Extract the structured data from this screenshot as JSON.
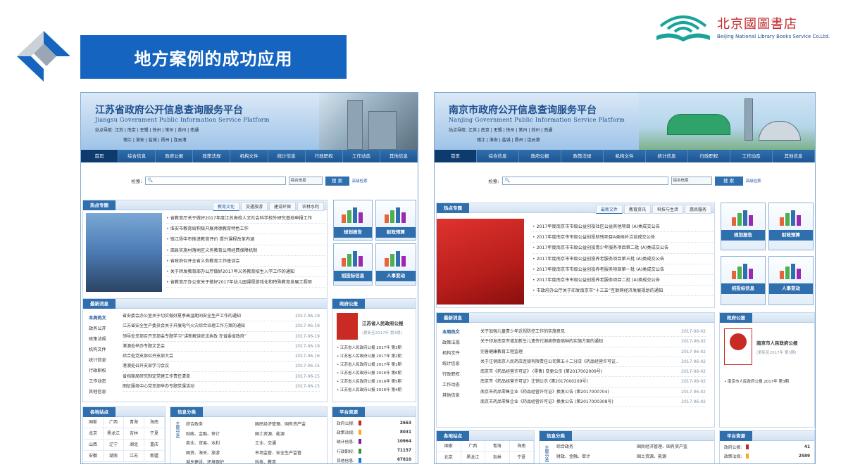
{
  "slide": {
    "title": "地方案例的成功应用",
    "brand": {
      "zh": "北京國圖書店",
      "en": "Beijing National Library Books Service Co.Ltd."
    }
  },
  "colors": {
    "accent": "#1565c0",
    "nav": "#1f5592",
    "brand_red": "#c0262b"
  },
  "left_site": {
    "title": "江苏省政府公开信息查询服务平台",
    "title_en": "Jiangsu Government Public Information Service Platform",
    "nav_label": "站点导航:",
    "nav_row1": [
      "江苏",
      "南京",
      "无锡",
      "徐州",
      "常州",
      "苏州",
      "南通"
    ],
    "nav_row2": [
      "镇江",
      "淮安",
      "盐城",
      "扬州",
      "连云港"
    ],
    "menu": [
      "首页",
      "综合信息",
      "政府公报",
      "政策法规",
      "机构文件",
      "统计信息",
      "行政职权",
      "工作动态",
      "其他信息"
    ],
    "search": {
      "label": "检索:",
      "select": "综合信息",
      "button": "搜 索",
      "advanced": "高级检索"
    },
    "hot": {
      "title": "热点专题",
      "tabs": [
        "教育文化",
        "交通旅游",
        "建设环保",
        "农林水利"
      ],
      "news": [
        "省教育厅关于做好2017年度江苏高校人文社会科学校外研究基地申报工作",
        "淮安市教育局积极开展师德教育特色工作",
        "镇江扬中市推进教育评价 提升课程改革内涵",
        "泗县实施村落地区义务教育公用经费保障机制",
        "省政府召开全省义务教育工作座谈会",
        "关于转发教育部办公厅做好2017年义务教育招生入学工作的通知",
        "省教育厅办公室关于做好2017年幼儿园课程游戏化和特殊教育发展工程项"
      ],
      "pager": [
        "1",
        "2",
        "3",
        "4",
        "5"
      ]
    },
    "side_buttons": [
      "规划报告",
      "财政预算",
      "招投标信息",
      "人事变动"
    ],
    "latest": {
      "title": "最新消息",
      "sidenav": [
        "本周热文",
        "政务公开",
        "政策法规",
        "机构文件",
        "统计信息",
        "行政职权",
        "工作动态",
        "其他信息"
      ],
      "items": [
        {
          "t": "省安委会办公室关于切实做好夏季高温期间安全生产工作的通知",
          "d": "2017-06-19"
        },
        {
          "t": "江苏省安全生产委员会关于开展电气火灾综合治理工作方案的通知",
          "d": "2017-06-19"
        },
        {
          "t": "领导处支部召开支部会专题学习“讲新解读依法执政 在省委省政府”",
          "d": "2017-06-19"
        },
        {
          "t": "港澳处举办专题文艺会",
          "d": "2017-06-19"
        },
        {
          "t": "综合处党支部召开支部大会",
          "d": "2017-06-16"
        },
        {
          "t": "港澳处召开支部学习会议",
          "d": "2017-06-15"
        },
        {
          "t": "省档案局研究制定党建工作责任清单",
          "d": "2017-06-15"
        },
        {
          "t": "图征服务中心党支部举办专题党课活动",
          "d": "2017-06-15"
        }
      ]
    },
    "gazette": {
      "title": "政府公报",
      "name": "江苏省人民政府公报",
      "sub": "(更新至2017年 第3期)",
      "issues": [
        "江苏省人民政府公报 2017年 第3期",
        "江苏省人民政府公报 2017年 第2期",
        "江苏省人民政府公报 2017年 第1期",
        "江苏省人民政府公报 2016年 第6期",
        "江苏省人民政府公报 2016年 第5期",
        "江苏省人民政府公报 2016年 第4期"
      ]
    },
    "stations": {
      "title": "各地站点",
      "cities": [
        "国家",
        "广西",
        "青海",
        "海南",
        "北京",
        "黑龙江",
        "吉林",
        "宁夏",
        "山西",
        "辽宁",
        "湖北",
        "重庆",
        "安徽",
        "湖南",
        "江苏",
        "新疆"
      ]
    },
    "info": {
      "title": "信息分类",
      "side": "主题分类",
      "col1": [
        "综合政务",
        "财政、金融、审计",
        "商业、贸易、水利",
        "国资、海关、旅游",
        "城乡建设、环境保护"
      ],
      "col2": [
        "国民经济管理、国有资产监",
        "国土资源、能源",
        "工业、交通",
        "市场监管、安全生产监管",
        "科技、教育"
      ]
    },
    "resources": {
      "title": "平台资源",
      "rows": [
        {
          "n": "政府公报:",
          "v": "2663"
        },
        {
          "n": "政策法规:",
          "v": "8031"
        },
        {
          "n": "统计信息:",
          "v": "10964"
        },
        {
          "n": "行政职权:",
          "v": "71157"
        },
        {
          "n": "其他信息:",
          "v": "67610"
        }
      ]
    }
  },
  "right_site": {
    "title": "南京市政府公开信息查询服务平台",
    "title_en": "Nanjing Government Public Information Service Platform",
    "nav_label": "站点导航:",
    "nav_row1": [
      "江苏",
      "南京",
      "无锡",
      "徐州",
      "常州",
      "苏州",
      "南通"
    ],
    "nav_row2": [
      "镇江",
      "淮安",
      "盐城",
      "扬州",
      "连云港"
    ],
    "menu": [
      "首页",
      "综合信息",
      "政府公报",
      "政策法规",
      "机构文件",
      "统计信息",
      "行政职权",
      "工作动态",
      "其他信息"
    ],
    "search": {
      "label": "检索:",
      "select": "综合信息",
      "button": "搜 索",
      "advanced": "高级检索"
    },
    "hot": {
      "title": "热点专题",
      "tabs": [
        "最新文件",
        "教育资讯",
        "科技与生活",
        "惠民服务"
      ],
      "news": [
        "2017年度南京市市级公益创投社区公益其他项目 (A)类成交公告",
        "2017年度南京市市级公益创投助残项目A类候补洽谈成交公告",
        "2017年度南京市市级公益创投青少年服务项目第二批 (A)类成交公告",
        "2017年度南京市市级公益创投养老服务项目第三批 (A)类成交公告",
        "2017年度南京市市级公益创投养老服务项目第一批 (A)类成交公告",
        "2017年度南京市市级公益创投养老服务项目二批 (A)类成交公告",
        "市政府办公厅关于印发南京市“十三五”互联网经济发展规划的通知"
      ],
      "pager": [
        "1",
        "2",
        "3",
        "4",
        "5"
      ]
    },
    "side_buttons": [
      "规划报告",
      "财政预算",
      "招投标信息",
      "人事变动"
    ],
    "latest": {
      "title": "最新消息",
      "sidenav": [
        "本周热文",
        "政策法规",
        "机构文件",
        "统计信息",
        "行政职权",
        "工作动态",
        "其他信息"
      ],
      "items": [
        {
          "t": "关于加强儿童青少年近视防控工作的实施意见",
          "d": "2017-06-02"
        },
        {
          "t": "关于印发南京市增加新生儿遗传代谢病筛查病种的实施方案的通知",
          "d": "2017-06-02"
        },
        {
          "t": "完善健康教育工程监理",
          "d": "2017-06-02"
        },
        {
          "t": "关于注销南京人民药店连锁有限责任公司第五十二分店《药品经营许可证..",
          "d": "2017-06-02"
        },
        {
          "t": "南京市《药品经营许可证》 (零售) 变更公示 (第2017002009号)",
          "d": "2017-06-02"
        },
        {
          "t": "南京市《药品经营许可证》注销公示 (第2017000209号)",
          "d": "2017-06-02"
        },
        {
          "t": "南京市药品零售企业《药品经营许可证》换发公告 (第2017000704)",
          "d": "2017-06-02"
        },
        {
          "t": "南京市药品零售企业《药品经营许可证》换发公告 (第2017000308号)",
          "d": "2017-06-02"
        }
      ]
    },
    "gazette": {
      "title": "政府公报",
      "name": "南京市人民政府公报",
      "sub": "(更新至2017年 第3期)",
      "issues": [
        "南京市人民政府公报 2017年 第3期"
      ]
    },
    "stations": {
      "title": "各地站点",
      "cities": [
        "国家",
        "广西",
        "青海",
        "海南",
        "北京",
        "黑龙江",
        "吉林",
        "宁夏"
      ]
    },
    "info": {
      "title": "信息分类",
      "side": "主题分类",
      "col1": [
        "综合政务",
        "财政、金融、审计"
      ],
      "col2": [
        "国民经济管理、国有资产监",
        "国土资源、能源"
      ]
    },
    "resources": {
      "title": "平台资源",
      "rows": [
        {
          "n": "政府公报:",
          "v": "41"
        },
        {
          "n": "政策法规:",
          "v": "2589"
        }
      ]
    }
  }
}
